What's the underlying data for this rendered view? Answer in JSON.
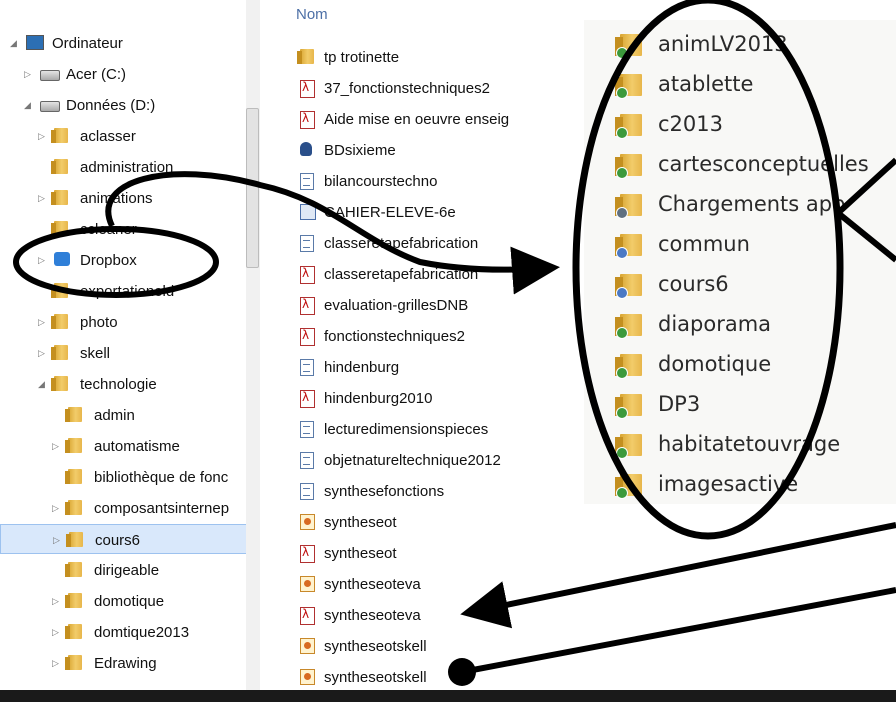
{
  "tree": {
    "nodes": [
      {
        "label": "Ordinateur",
        "icon": "computer-icon",
        "expander": "expanded"
      },
      {
        "label": "Acer (C:)",
        "icon": "drive-icon",
        "expander": "collapsed"
      },
      {
        "label": "Données (D:)",
        "icon": "drive-icon",
        "expander": "expanded"
      },
      {
        "label": "aclasser",
        "icon": "folder-icon",
        "expander": "collapsed"
      },
      {
        "label": "administration",
        "icon": "folder-icon",
        "expander": "none"
      },
      {
        "label": "animations",
        "icon": "folder-icon",
        "expander": "collapsed"
      },
      {
        "label": "ccleaner",
        "icon": "folder-icon",
        "expander": "none"
      },
      {
        "label": "Dropbox",
        "icon": "dropbox-icon",
        "expander": "collapsed"
      },
      {
        "label": "exportationold",
        "icon": "folder-icon",
        "expander": "none"
      },
      {
        "label": "photo",
        "icon": "folder-icon",
        "expander": "collapsed"
      },
      {
        "label": "skell",
        "icon": "folder-icon",
        "expander": "collapsed"
      },
      {
        "label": "technologie",
        "icon": "folder-icon",
        "expander": "expanded"
      },
      {
        "label": "admin",
        "icon": "folder-icon",
        "expander": "none"
      },
      {
        "label": "automatisme",
        "icon": "folder-icon",
        "expander": "collapsed"
      },
      {
        "label": "bibliothèque de fonc",
        "icon": "folder-icon",
        "expander": "none"
      },
      {
        "label": "composantsinternep",
        "icon": "folder-icon",
        "expander": "collapsed"
      },
      {
        "label": "cours6",
        "icon": "folder-icon",
        "expander": "collapsed",
        "selected": true
      },
      {
        "label": "dirigeable",
        "icon": "folder-icon",
        "expander": "none"
      },
      {
        "label": "domotique",
        "icon": "folder-icon",
        "expander": "collapsed"
      },
      {
        "label": "domtique2013",
        "icon": "folder-icon",
        "expander": "collapsed"
      },
      {
        "label": "Edrawing",
        "icon": "folder-icon",
        "expander": "collapsed"
      }
    ]
  },
  "filelist": {
    "column_header": "Nom",
    "files": [
      {
        "label": "tp trotinette",
        "type": "folder-icon"
      },
      {
        "label": "37_fonctionstechniques2",
        "type": "pdf-icon"
      },
      {
        "label": "Aide mise en oeuvre enseig",
        "type": "pdf-icon"
      },
      {
        "label": "BDsixieme",
        "type": "app-icon"
      },
      {
        "label": "bilancourstechno",
        "type": "document-icon"
      },
      {
        "label": "CAHIER-ELEVE-6e",
        "type": "image-doc-icon"
      },
      {
        "label": "classeretapefabrication",
        "type": "document-icon"
      },
      {
        "label": "classeretapefabrication",
        "type": "pdf-icon"
      },
      {
        "label": "evaluation-grillesDNB",
        "type": "pdf-icon"
      },
      {
        "label": "fonctionstechniques2",
        "type": "pdf-icon"
      },
      {
        "label": "hindenburg",
        "type": "document-icon"
      },
      {
        "label": "hindenburg2010",
        "type": "pdf-icon"
      },
      {
        "label": "lecturedimensionspieces",
        "type": "document-icon"
      },
      {
        "label": "objetnatureltechnique2012",
        "type": "document-icon"
      },
      {
        "label": "synthesefonctions",
        "type": "document-icon"
      },
      {
        "label": "syntheseot",
        "type": "presentation-icon"
      },
      {
        "label": "syntheseot",
        "type": "pdf-icon"
      },
      {
        "label": "syntheseoteva",
        "type": "presentation-icon"
      },
      {
        "label": "syntheseoteva",
        "type": "pdf-icon"
      },
      {
        "label": "syntheseotskell",
        "type": "presentation-icon"
      },
      {
        "label": "syntheseotskell",
        "type": "presentation-icon"
      }
    ]
  },
  "zoomed_folders": {
    "items": [
      {
        "label": "animLV2013",
        "icon": "synced-folder-icon"
      },
      {
        "label": "atablette",
        "icon": "synced-folder-icon"
      },
      {
        "label": "c2013",
        "icon": "synced-folder-icon"
      },
      {
        "label": "cartesconceptuelles",
        "icon": "synced-folder-icon"
      },
      {
        "label": "Chargements app",
        "icon": "downloads-folder-icon"
      },
      {
        "label": "commun",
        "icon": "shared-folder-icon"
      },
      {
        "label": "cours6",
        "icon": "shared-folder-icon"
      },
      {
        "label": "diaporama",
        "icon": "synced-folder-icon"
      },
      {
        "label": "domotique",
        "icon": "synced-folder-icon"
      },
      {
        "label": "DP3",
        "icon": "synced-folder-icon"
      },
      {
        "label": "habitatetouvrage",
        "icon": "synced-folder-icon"
      },
      {
        "label": "imagesactive",
        "icon": "synced-folder-icon"
      }
    ]
  },
  "colors": {
    "selection": "#d9e8fb",
    "header_text": "#4c6fa6",
    "annotation": "#000000",
    "sync_badge": "#3c9a3c"
  }
}
